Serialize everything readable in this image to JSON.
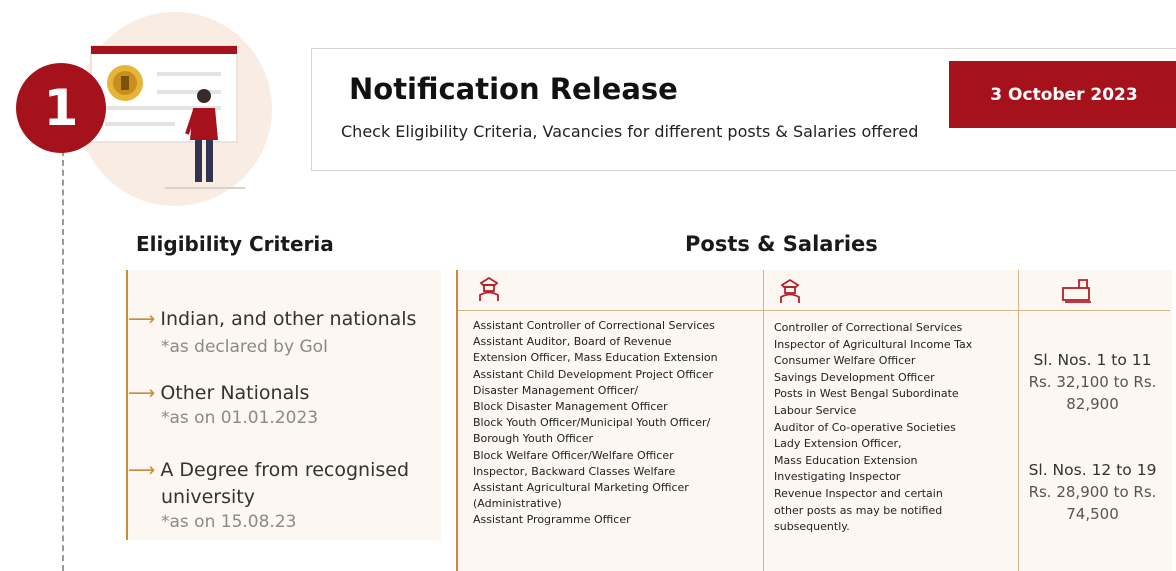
{
  "step": {
    "number": "1"
  },
  "notification": {
    "title": "Notification Release",
    "subtitle": "Check Eligibility Criteria, Vacancies for different posts & Salaries offered",
    "date": "3 October 2023"
  },
  "eligibility": {
    "heading": "Eligibility Criteria",
    "items": [
      {
        "main": "Indian, and other nationals",
        "note": "*as declared by GoI"
      },
      {
        "main": "Other Nationals",
        "note": "*as on 01.01.2023"
      },
      {
        "main_line1": "A Degree from recognised",
        "main_line2": "university",
        "note": "*as on 15.08.23"
      }
    ]
  },
  "posts": {
    "heading": "Posts & Salaries",
    "column1": [
      "Assistant Controller of Correctional Services",
      "Assistant Auditor, Board of Revenue",
      "Extension Officer, Mass Education Extension",
      "Assistant Child Development Project Officer",
      "Disaster Management Officer/",
      "Block Disaster Management Officer",
      "Block Youth Officer/Municipal Youth Officer/",
      "Borough Youth Officer",
      "Block Welfare Officer/Welfare Officer",
      "Inspector, Backward Classes Welfare",
      "Assistant Agricultural Marketing Officer",
      "(Administrative)",
      "Assistant Programme Officer"
    ],
    "column2": [
      "Controller of Correctional Services",
      "Inspector of Agricultural Income Tax",
      "Consumer Welfare Officer",
      "Savings Development Officer",
      "Posts in West Bengal Subordinate",
      "Labour Service",
      "Auditor of Co-operative Societies",
      "Lady Extension Officer,",
      "Mass Education Extension",
      "Investigating Inspector",
      "Revenue Inspector and certain",
      "other posts as may be notified",
      "subsequently."
    ],
    "salaries": [
      {
        "range": "Sl. Nos. 1 to 11",
        "amount_line1": "Rs. 32,100 to Rs.",
        "amount_line2": "82,900"
      },
      {
        "range": "Sl. Nos. 12 to 19",
        "amount_line1": "Rs. 28,900 to Rs.",
        "amount_line2": "74,500"
      }
    ]
  },
  "icons": {
    "officer": "officer-icon",
    "money": "money-stack-icon",
    "emblem": "emblem-icon",
    "person": "person-icon"
  },
  "colors": {
    "accent": "#a6121b",
    "border": "#c88a3d",
    "panel": "#fcf7f1"
  }
}
